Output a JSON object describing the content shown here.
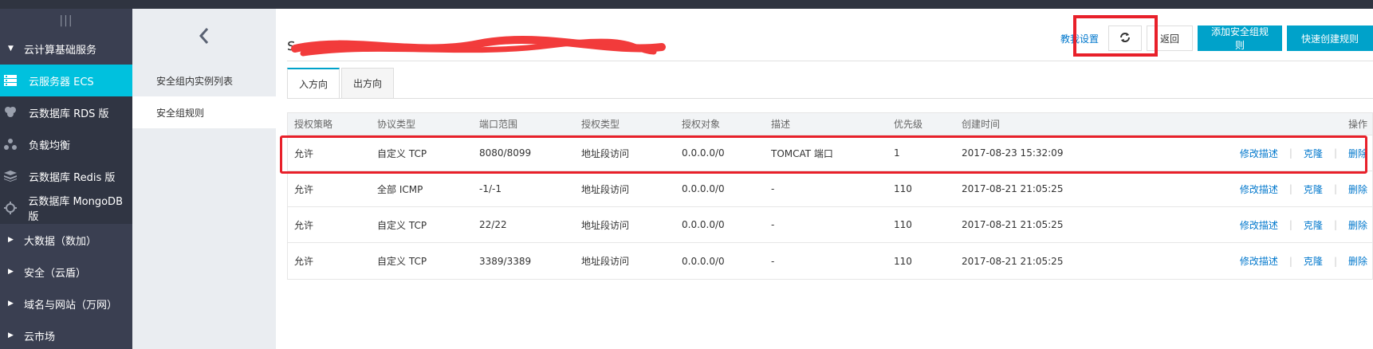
{
  "sidebar": {
    "toggle": "|||",
    "items": [
      {
        "type": "group",
        "label": "云计算基础服务",
        "icon": "caret-down-icon",
        "caret": "▼"
      },
      {
        "type": "sub",
        "label": "云服务器 ECS",
        "icon": "server-icon",
        "active": true
      },
      {
        "type": "sub",
        "label": "云数据库 RDS 版",
        "icon": "database-rds-icon"
      },
      {
        "type": "sub",
        "label": "负载均衡",
        "icon": "load-balancer-icon"
      },
      {
        "type": "sub",
        "label": "云数据库 Redis 版",
        "icon": "redis-icon"
      },
      {
        "type": "sub",
        "label": "云数据库 MongoDB 版",
        "icon": "mongodb-icon"
      },
      {
        "type": "group",
        "label": "大数据（数加）",
        "icon": "caret-right-icon",
        "caret": "▶"
      },
      {
        "type": "group",
        "label": "安全（云盾）",
        "icon": "caret-right-icon",
        "caret": "▶"
      },
      {
        "type": "group",
        "label": "域名与网站（万网）",
        "icon": "caret-right-icon",
        "caret": "▶"
      },
      {
        "type": "group",
        "label": "云市场",
        "icon": "caret-right-icon",
        "caret": "▶"
      }
    ]
  },
  "subnav": {
    "back_icon": "chevron-left-icon",
    "items": [
      {
        "label": "安全组内实例列表",
        "active": false
      },
      {
        "label": "安全组规则",
        "active": true
      }
    ]
  },
  "header": {
    "title": "s",
    "help_link": "教我设置",
    "refresh_icon": "refresh-icon",
    "back_label": "返回",
    "add_rule_label": "添加安全组规则",
    "quick_create_label": "快速创建规则"
  },
  "tabs": [
    {
      "label": "入方向",
      "active": true
    },
    {
      "label": "出方向",
      "active": false
    }
  ],
  "table": {
    "columns": [
      "授权策略",
      "协议类型",
      "端口范围",
      "授权类型",
      "授权对象",
      "描述",
      "优先级",
      "创建时间",
      "操作"
    ],
    "rows": [
      [
        "允许",
        "自定义 TCP",
        "8080/8099",
        "地址段访问",
        "0.0.0.0/0",
        "TOMCAT 端口",
        "1",
        "2017-08-23 15:32:09"
      ],
      [
        "允许",
        "全部 ICMP",
        "-1/-1",
        "地址段访问",
        "0.0.0.0/0",
        "-",
        "110",
        "2017-08-21 21:05:25"
      ],
      [
        "允许",
        "自定义 TCP",
        "22/22",
        "地址段访问",
        "0.0.0.0/0",
        "-",
        "110",
        "2017-08-21 21:05:25"
      ],
      [
        "允许",
        "自定义 TCP",
        "3389/3389",
        "地址段访问",
        "0.0.0.0/0",
        "-",
        "110",
        "2017-08-21 21:05:25"
      ]
    ],
    "row_actions": {
      "edit": "修改描述",
      "clone": "克隆",
      "delete": "删除"
    }
  },
  "colors": {
    "sidebar_bg": "#3a3f51",
    "sidebar_active": "#00c1de",
    "primary": "#00a2ca",
    "link": "#0077cc",
    "highlight": "#e8202a"
  }
}
